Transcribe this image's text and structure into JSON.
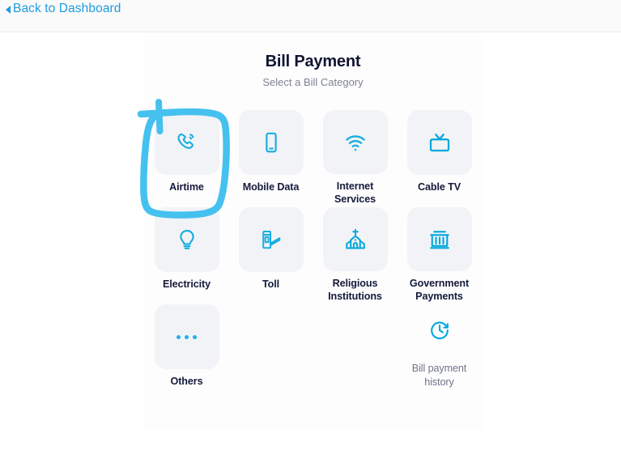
{
  "topbar": {
    "back_label": "Back to Dashboard",
    "back_icon": "caret-left-icon"
  },
  "header": {
    "title": "Bill Payment",
    "subtitle": "Select a Bill Category"
  },
  "colors": {
    "accent": "#1e9ce0",
    "icon": "#16aee0",
    "tile_bg": "#f2f3f6",
    "title": "#0f1533",
    "subtitle": "#7e8393",
    "annotation": "#45c1ef",
    "page_bg": "#ffffff",
    "topbar_bg": "#fafafa",
    "card_bg": "#fdfdfe"
  },
  "categories": [
    {
      "label": "Airtime",
      "icon": "phone-call-icon",
      "style": "tile",
      "annotated": true
    },
    {
      "label": "Mobile Data",
      "icon": "smartphone-icon",
      "style": "tile",
      "annotated": false
    },
    {
      "label": "Internet Services",
      "icon": "wifi-icon",
      "style": "tile",
      "annotated": false
    },
    {
      "label": "Cable TV",
      "icon": "television-icon",
      "style": "tile",
      "annotated": false
    },
    {
      "label": "Electricity",
      "icon": "light-bulb-icon",
      "style": "tile",
      "annotated": false
    },
    {
      "label": "Toll",
      "icon": "toll-gate-icon",
      "style": "tile",
      "annotated": false
    },
    {
      "label": "Religious Institutions",
      "icon": "church-icon",
      "style": "tile",
      "annotated": false
    },
    {
      "label": "Government Payments",
      "icon": "bank-building-icon",
      "style": "tile",
      "annotated": false
    },
    {
      "label": "Others",
      "icon": "ellipsis-icon",
      "style": "tile",
      "annotated": false
    },
    {
      "label": "",
      "icon": "",
      "style": "empty",
      "annotated": false
    },
    {
      "label": "",
      "icon": "",
      "style": "empty",
      "annotated": false
    },
    {
      "label": "Bill payment history",
      "icon": "clock-history-icon",
      "style": "plain",
      "annotated": false
    }
  ],
  "annotation": {
    "shape": "hand-drawn-loop",
    "target": "Airtime"
  }
}
